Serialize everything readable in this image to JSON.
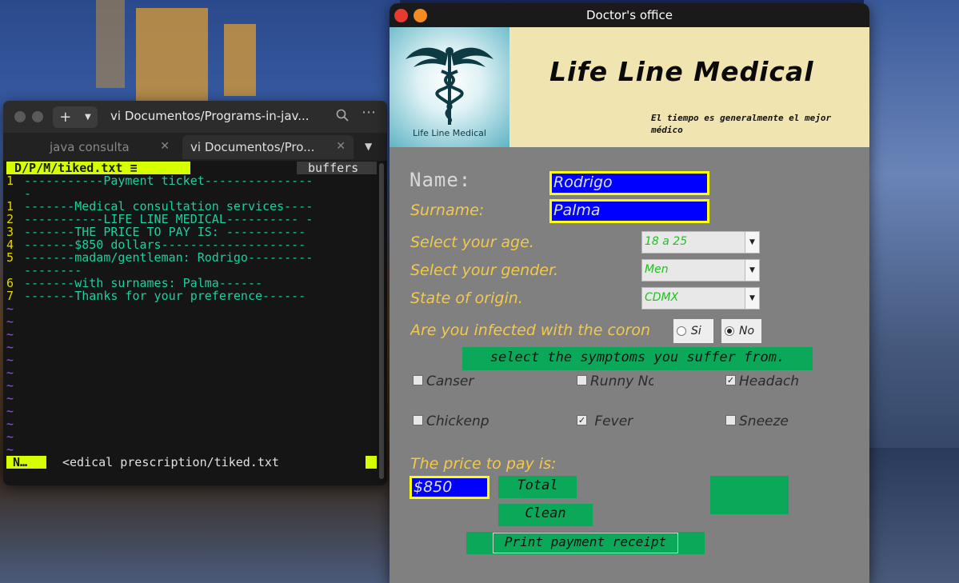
{
  "terminal": {
    "title": "vi Documentos/Programs-in-jav...",
    "tabs": [
      {
        "label": "java consulta"
      },
      {
        "label": "vi Documentos/Pro..."
      }
    ],
    "vim": {
      "path": "D/P/M/tiked.txt",
      "buffers_label": "buffers",
      "lines": [
        {
          "num": "1",
          "text": "-----------Payment ticket---------------"
        },
        {
          "num": "",
          "text": "-"
        },
        {
          "num": "1",
          "text": "-------Medical consultation services----"
        },
        {
          "num": "2",
          "text": "-----------LIFE LINE MEDICAL---------- -"
        },
        {
          "num": "3",
          "text": "-------THE PRICE TO PAY IS: -----------"
        },
        {
          "num": "4",
          "text": "-------$850 dollars--------------------"
        },
        {
          "num": "5",
          "text": "-------madam/gentleman: Rodrigo---------"
        },
        {
          "num": "",
          "text": "--------"
        },
        {
          "num": "6",
          "text": "-------with surnames: Palma------"
        },
        {
          "num": "7",
          "text": "-------Thanks for your preference------"
        }
      ],
      "tilde": "~",
      "mode": "N…",
      "status_file": "<edical prescription/tiked.txt"
    }
  },
  "app": {
    "window_title": "Doctor's office",
    "logo_text": "Life Line Medical",
    "banner_title": "Life Line Medical",
    "banner_subtitle": "El tiempo es generalmente el mejor médico",
    "name_label": "Name:",
    "name_value": "Rodrigo",
    "surname_label": "Surname:",
    "surname_value": "Palma",
    "age_label": "Select your age.",
    "age_value": "18 a 25",
    "gender_label": "Select your gender.",
    "gender_value": "Men",
    "state_label": "State of origin.",
    "state_value": "CDMX",
    "infected_label": "Are you infected with the coron",
    "radio_yes": "Si",
    "radio_no": "No",
    "symptoms_header": "select the symptoms you suffer from.",
    "symptoms": [
      {
        "label": "Canser",
        "checked": false
      },
      {
        "label": "Runny No",
        "checked": false
      },
      {
        "label": "Headach",
        "checked": true
      },
      {
        "label": "Chickenp",
        "checked": false
      },
      {
        "label": "Fever",
        "checked": true
      },
      {
        "label": "Sneeze",
        "checked": false
      }
    ],
    "price_label": "The price to pay is:",
    "price_value": "$850",
    "total_button": "Total",
    "clean_button": "Clean",
    "print_button": "Print payment receipt"
  },
  "colors": {
    "accent_green": "#0ba85a",
    "label_yellow": "#f2c94c",
    "field_blue": "#0000ff",
    "banner_bg": "#f0e4b0",
    "close_red": "#e83a2e",
    "minimize_orange": "#f58a1f"
  }
}
